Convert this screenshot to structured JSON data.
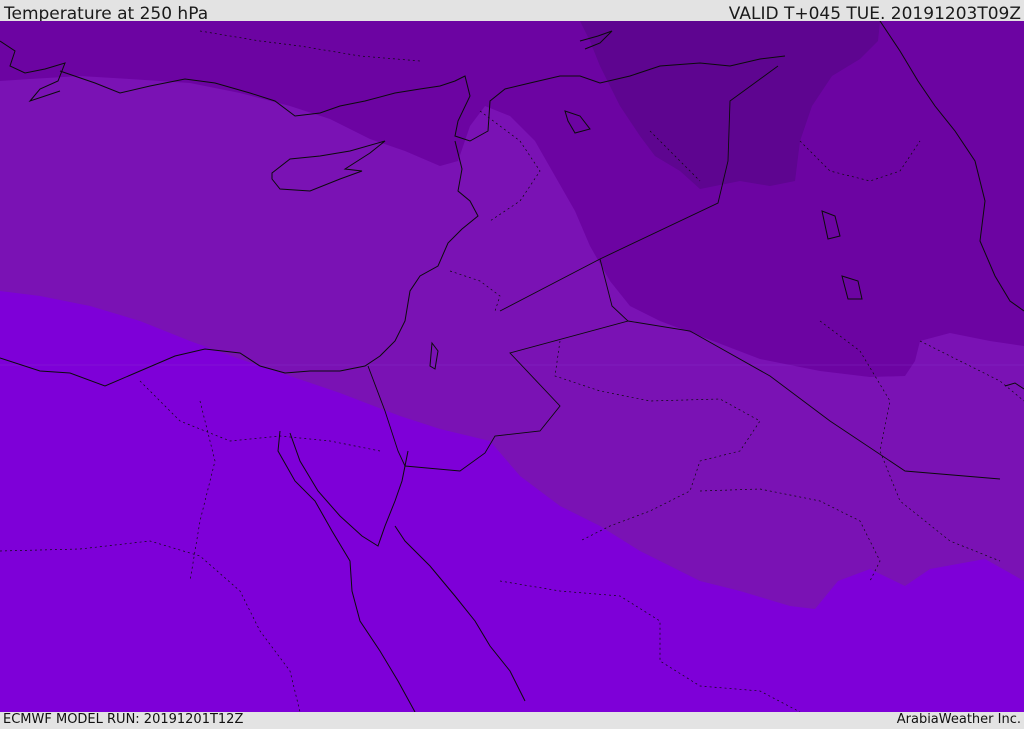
{
  "header": {
    "title": "Temperature at 250 hPa",
    "valid": "VALID T+045 TUE. 20191203T09Z"
  },
  "footer": {
    "model_run": "ECMWF MODEL RUN: 20191201T12Z",
    "credit": "ArabiaWeather Inc."
  },
  "map": {
    "colors": {
      "warmest_band": "#7e00d8",
      "mid_band": "#7a12b4",
      "cool_band": "#6c04a2",
      "coldest_band": "#5e0590",
      "coastline": "#0b0b0b"
    },
    "temperature_bands": [
      "warmest",
      "mid",
      "cool",
      "coldest"
    ]
  }
}
